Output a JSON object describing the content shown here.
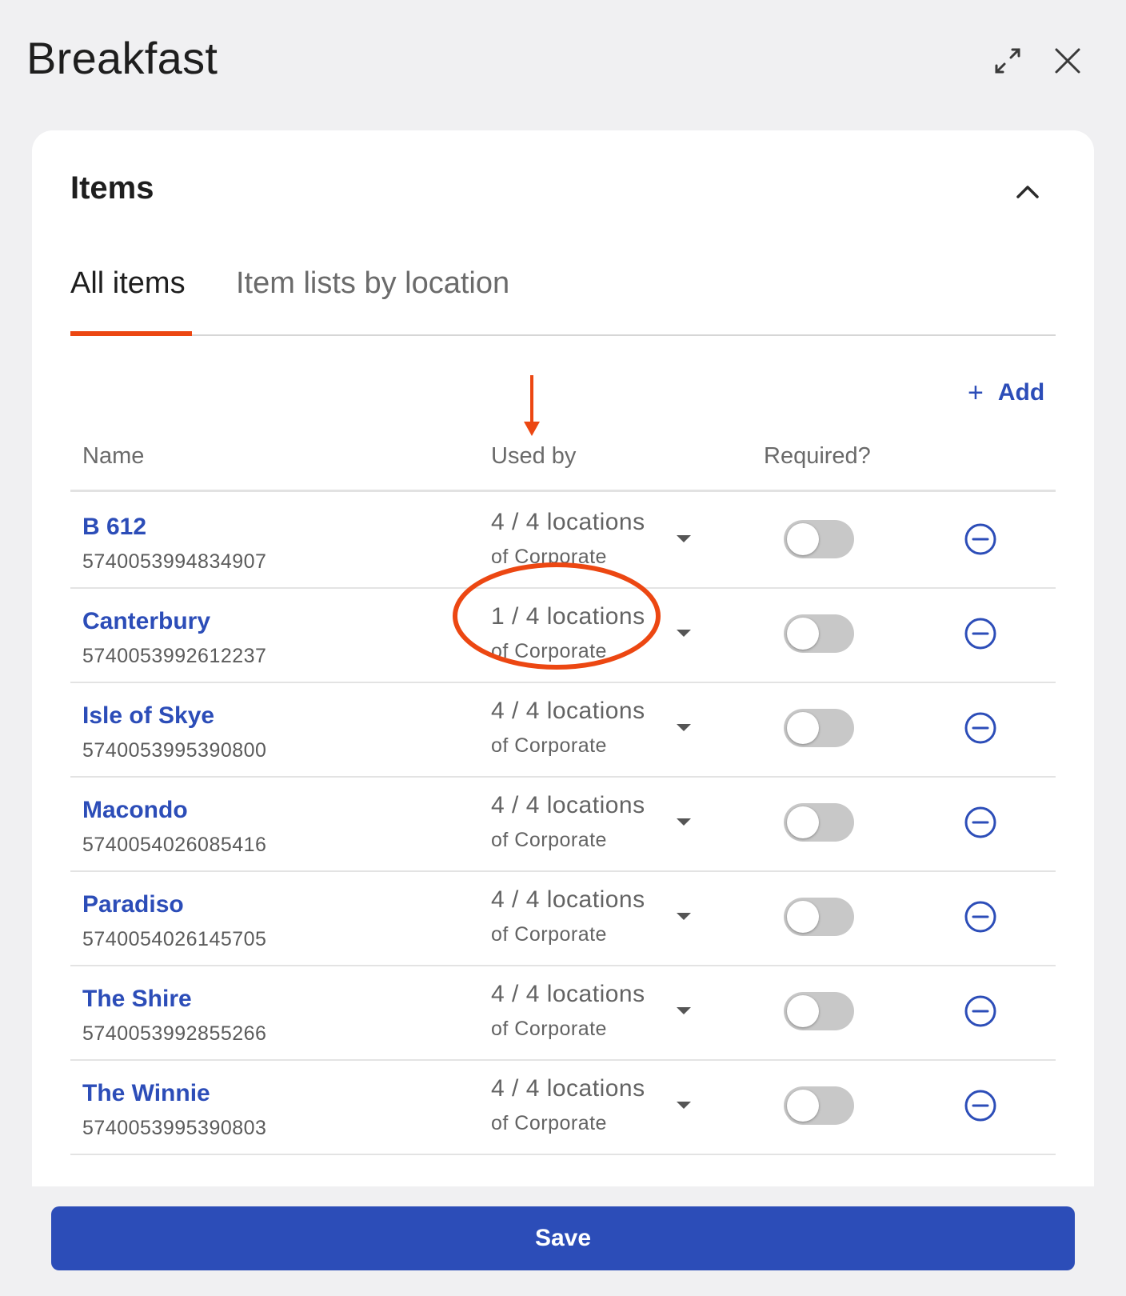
{
  "header": {
    "title": "Breakfast",
    "expand_icon": "expand-icon",
    "close_icon": "close-icon"
  },
  "section": {
    "title": "Items",
    "collapse_icon": "chevron-up-icon"
  },
  "tabs": [
    {
      "label": "All items",
      "active": true
    },
    {
      "label": "Item lists by location",
      "active": false
    }
  ],
  "add": {
    "label": "Add",
    "icon": "+"
  },
  "columns": {
    "name": "Name",
    "used_by": "Used by",
    "required": "Required?"
  },
  "rows": [
    {
      "name": "B 612",
      "code": "5740053994834907",
      "used": "4 / 4 locations",
      "used_sub": "of Corporate",
      "required": false
    },
    {
      "name": "Canterbury",
      "code": "5740053992612237",
      "used": "1 / 4 locations",
      "used_sub": "of Corporate",
      "required": false
    },
    {
      "name": "Isle of Skye",
      "code": "5740053995390800",
      "used": "4 / 4 locations",
      "used_sub": "of Corporate",
      "required": false
    },
    {
      "name": "Macondo",
      "code": "5740054026085416",
      "used": "4 / 4 locations",
      "used_sub": "of Corporate",
      "required": false
    },
    {
      "name": "Paradiso",
      "code": "5740054026145705",
      "used": "4 / 4 locations",
      "used_sub": "of Corporate",
      "required": false
    },
    {
      "name": "The Shire",
      "code": "5740053992855266",
      "used": "4 / 4 locations",
      "used_sub": "of Corporate",
      "required": false
    },
    {
      "name": "The Winnie",
      "code": "5740053995390803",
      "used": "4 / 4 locations",
      "used_sub": "of Corporate",
      "required": false
    }
  ],
  "footer": {
    "save_label": "Save"
  },
  "colors": {
    "accent": "#2c4db8",
    "highlight": "#ec4712",
    "toggle_off": "#c8c8c8"
  }
}
